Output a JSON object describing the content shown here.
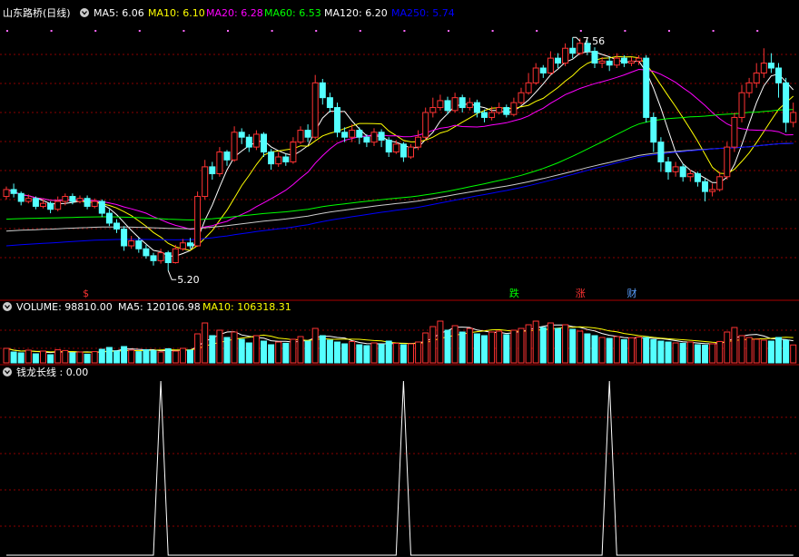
{
  "main_header": {
    "title": "山东路桥(日线)",
    "items": [
      {
        "label": "MA5: 6.06",
        "color": "#ffffff"
      },
      {
        "label": "MA10: 6.10",
        "color": "#ffff00"
      },
      {
        "label": "MA20: 6.28",
        "color": "#ff00ff"
      },
      {
        "label": "MA60: 6.53",
        "color": "#00ff00"
      },
      {
        "label": "MA120: 6.20",
        "color": "#ffffff"
      },
      {
        "label": "MA250: 5.74",
        "color": "#0000ff"
      }
    ]
  },
  "volume_header": {
    "items": [
      {
        "label": "VOLUME: 98810.00",
        "color": "#ffffff"
      },
      {
        "label": "MA5: 120106.98",
        "color": "#ffffff"
      },
      {
        "label": "MA10: 106318.31",
        "color": "#ffff00"
      }
    ]
  },
  "indicator_header": {
    "label": "钱龙长线 : 0.00",
    "color": "#ffffff"
  },
  "colors": {
    "up": "#ff3333",
    "down": "#54ffff",
    "grid": "#8b0000",
    "bg": "#000000"
  },
  "chart_data": {
    "type": "candlestick",
    "price_range": [
      5.0,
      7.7
    ],
    "high_label": "7.56",
    "low_label": "5.20",
    "candles": [
      [
        5.95,
        6.02,
        6.05,
        5.92
      ],
      [
        6.02,
        5.98,
        6.08,
        5.94
      ],
      [
        5.98,
        5.9,
        6.0,
        5.86
      ],
      [
        5.9,
        5.93,
        5.97,
        5.88
      ],
      [
        5.93,
        5.85,
        5.95,
        5.82
      ],
      [
        5.85,
        5.88,
        5.92,
        5.83
      ],
      [
        5.88,
        5.82,
        5.9,
        5.78
      ],
      [
        5.82,
        5.9,
        5.95,
        5.8
      ],
      [
        5.9,
        5.95,
        5.98,
        5.86
      ],
      [
        5.95,
        5.9,
        5.98,
        5.87
      ],
      [
        5.9,
        5.93,
        5.96,
        5.88
      ],
      [
        5.93,
        5.85,
        5.96,
        5.82
      ],
      [
        5.85,
        5.9,
        5.93,
        5.83
      ],
      [
        5.9,
        5.78,
        5.92,
        5.74
      ],
      [
        5.78,
        5.68,
        5.82,
        5.65
      ],
      [
        5.68,
        5.62,
        5.72,
        5.58
      ],
      [
        5.62,
        5.45,
        5.65,
        5.4
      ],
      [
        5.45,
        5.5,
        5.55,
        5.42
      ],
      [
        5.5,
        5.42,
        5.53,
        5.38
      ],
      [
        5.42,
        5.35,
        5.46,
        5.32
      ],
      [
        5.35,
        5.3,
        5.38,
        5.25
      ],
      [
        5.3,
        5.38,
        5.42,
        5.27
      ],
      [
        5.38,
        5.28,
        5.4,
        5.2
      ],
      [
        5.28,
        5.42,
        5.46,
        5.27
      ],
      [
        5.42,
        5.48,
        5.52,
        5.4
      ],
      [
        5.48,
        5.45,
        5.53,
        5.42
      ],
      [
        5.45,
        5.95,
        6.0,
        5.44
      ],
      [
        5.95,
        6.25,
        6.32,
        5.92
      ],
      [
        6.25,
        6.18,
        6.3,
        6.12
      ],
      [
        6.18,
        6.4,
        6.45,
        6.15
      ],
      [
        6.4,
        6.32,
        6.42,
        6.26
      ],
      [
        6.32,
        6.6,
        6.66,
        6.3
      ],
      [
        6.6,
        6.55,
        6.64,
        6.48
      ],
      [
        6.55,
        6.45,
        6.58,
        6.4
      ],
      [
        6.45,
        6.58,
        6.62,
        6.42
      ],
      [
        6.58,
        6.4,
        6.6,
        6.35
      ],
      [
        6.4,
        6.28,
        6.43,
        6.22
      ],
      [
        6.28,
        6.35,
        6.4,
        6.25
      ],
      [
        6.35,
        6.3,
        6.38,
        6.26
      ],
      [
        6.3,
        6.5,
        6.55,
        6.28
      ],
      [
        6.5,
        6.62,
        6.66,
        6.48
      ],
      [
        6.62,
        6.55,
        6.68,
        6.5
      ],
      [
        6.55,
        7.1,
        7.18,
        6.53
      ],
      [
        7.1,
        6.95,
        7.14,
        6.88
      ],
      [
        6.95,
        6.85,
        7.0,
        6.8
      ],
      [
        6.85,
        6.6,
        6.9,
        6.55
      ],
      [
        6.6,
        6.55,
        6.65,
        6.5
      ],
      [
        6.55,
        6.62,
        6.68,
        6.5
      ],
      [
        6.62,
        6.55,
        6.65,
        6.48
      ],
      [
        6.55,
        6.5,
        6.58,
        6.45
      ],
      [
        6.5,
        6.6,
        6.64,
        6.46
      ],
      [
        6.6,
        6.52,
        6.63,
        6.45
      ],
      [
        6.52,
        6.4,
        6.55,
        6.35
      ],
      [
        6.4,
        6.48,
        6.52,
        6.38
      ],
      [
        6.48,
        6.35,
        6.5,
        6.3
      ],
      [
        6.35,
        6.45,
        6.48,
        6.33
      ],
      [
        6.45,
        6.55,
        6.62,
        6.42
      ],
      [
        6.55,
        6.8,
        6.85,
        6.52
      ],
      [
        6.8,
        6.85,
        6.95,
        6.75
      ],
      [
        6.85,
        6.92,
        6.98,
        6.82
      ],
      [
        6.92,
        6.82,
        6.96,
        6.78
      ],
      [
        6.82,
        6.95,
        7.0,
        6.8
      ],
      [
        6.95,
        6.85,
        6.98,
        6.8
      ],
      [
        6.85,
        6.9,
        6.95,
        6.82
      ],
      [
        6.9,
        6.8,
        6.93,
        6.75
      ],
      [
        6.8,
        6.75,
        6.83,
        6.7
      ],
      [
        6.75,
        6.8,
        6.86,
        6.72
      ],
      [
        6.8,
        6.85,
        6.9,
        6.78
      ],
      [
        6.85,
        6.78,
        6.88,
        6.75
      ],
      [
        6.78,
        6.9,
        6.95,
        6.76
      ],
      [
        6.9,
        7.0,
        7.05,
        6.88
      ],
      [
        7.0,
        7.1,
        7.2,
        6.98
      ],
      [
        7.1,
        7.25,
        7.3,
        7.08
      ],
      [
        7.25,
        7.2,
        7.28,
        7.15
      ],
      [
        7.2,
        7.35,
        7.42,
        7.18
      ],
      [
        7.35,
        7.3,
        7.4,
        7.25
      ],
      [
        7.3,
        7.45,
        7.5,
        7.27
      ],
      [
        7.45,
        7.4,
        7.56,
        7.35
      ],
      [
        7.4,
        7.5,
        7.55,
        7.38
      ],
      [
        7.5,
        7.42,
        7.53,
        7.38
      ],
      [
        7.42,
        7.3,
        7.46,
        7.25
      ],
      [
        7.3,
        7.32,
        7.36,
        7.25
      ],
      [
        7.32,
        7.28,
        7.36,
        7.22
      ],
      [
        7.28,
        7.35,
        7.4,
        7.25
      ],
      [
        7.35,
        7.3,
        7.38,
        7.26
      ],
      [
        7.3,
        7.32,
        7.36,
        7.27
      ],
      [
        7.32,
        7.35,
        7.38,
        7.28
      ],
      [
        7.35,
        6.75,
        7.38,
        6.7
      ],
      [
        6.75,
        6.5,
        6.8,
        6.4
      ],
      [
        6.5,
        6.3,
        6.55,
        6.2
      ],
      [
        6.3,
        6.2,
        6.35,
        6.12
      ],
      [
        6.2,
        6.25,
        6.3,
        6.15
      ],
      [
        6.25,
        6.15,
        6.28,
        6.1
      ],
      [
        6.15,
        6.18,
        6.22,
        6.1
      ],
      [
        6.18,
        6.1,
        6.2,
        6.05
      ],
      [
        6.1,
        6.0,
        6.13,
        5.9
      ],
      [
        6.0,
        6.02,
        6.08,
        5.95
      ],
      [
        6.02,
        6.15,
        6.2,
        6.0
      ],
      [
        6.15,
        6.45,
        6.5,
        6.12
      ],
      [
        6.45,
        6.75,
        6.8,
        6.4
      ],
      [
        6.75,
        7.0,
        7.08,
        6.7
      ],
      [
        7.0,
        7.1,
        7.15,
        6.95
      ],
      [
        7.1,
        7.2,
        7.3,
        7.05
      ],
      [
        7.2,
        7.3,
        7.45,
        7.15
      ],
      [
        7.3,
        7.25,
        7.4,
        7.2
      ],
      [
        7.25,
        7.1,
        7.3,
        6.95
      ],
      [
        7.1,
        6.7,
        7.15,
        6.6
      ],
      [
        6.7,
        6.8,
        6.9,
        6.65
      ]
    ],
    "volume_range": [
      0,
      260000
    ],
    "volume": [
      80000,
      60000,
      55000,
      70000,
      50000,
      65000,
      45000,
      72000,
      68000,
      55000,
      60000,
      48000,
      62000,
      75000,
      85000,
      65000,
      90000,
      70000,
      62000,
      72000,
      68000,
      60000,
      78000,
      65000,
      80000,
      70000,
      160000,
      220000,
      150000,
      180000,
      140000,
      170000,
      130000,
      110000,
      150000,
      120000,
      100000,
      115000,
      108000,
      130000,
      145000,
      120000,
      190000,
      150000,
      125000,
      115000,
      105000,
      118000,
      100000,
      95000,
      110000,
      102000,
      120000,
      108000,
      100000,
      105000,
      115000,
      165000,
      200000,
      230000,
      180000,
      205000,
      170000,
      190000,
      160000,
      150000,
      170000,
      175000,
      155000,
      180000,
      190000,
      210000,
      230000,
      195000,
      220000,
      190000,
      210000,
      185000,
      175000,
      160000,
      150000,
      140000,
      135000,
      145000,
      128000,
      138000,
      142000,
      140000,
      128000,
      120000,
      115000,
      110000,
      108000,
      115000,
      100000,
      98000,
      105000,
      118000,
      170000,
      195000,
      150000,
      140000,
      130000,
      125000,
      120000,
      140000,
      125000,
      98810
    ],
    "indicator_range": [
      0,
      1
    ],
    "indicator_spikes": [
      21,
      54,
      82
    ],
    "markers": [
      {
        "index": 11,
        "label": "$",
        "color": "#ff3333"
      },
      {
        "index": 69,
        "label": "跌",
        "color": "#00ff00"
      },
      {
        "index": 78,
        "label": "涨",
        "color": "#ff3333"
      },
      {
        "index": 85,
        "label": "财",
        "color": "#5aa0ff"
      }
    ]
  }
}
